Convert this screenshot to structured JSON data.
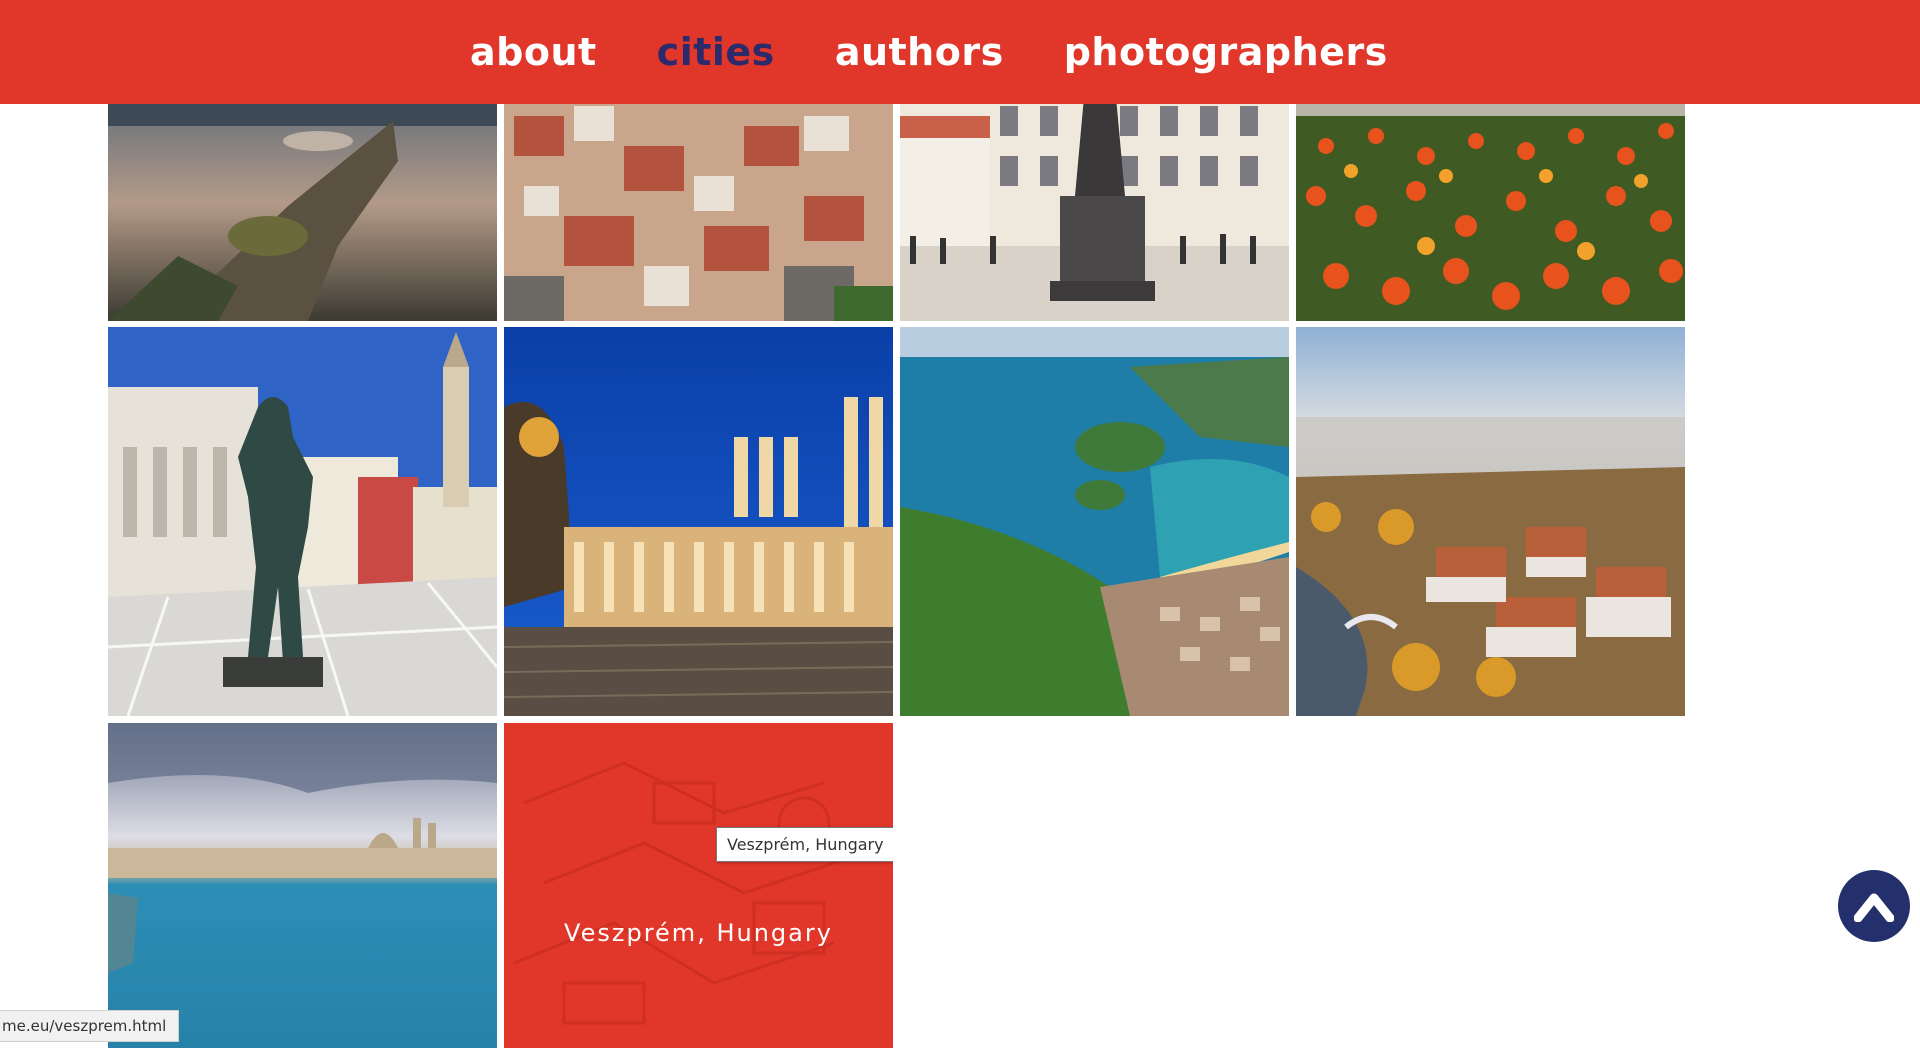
{
  "nav": {
    "items": [
      {
        "label": "about",
        "active": false
      },
      {
        "label": "cities",
        "active": true
      },
      {
        "label": "authors",
        "active": false
      },
      {
        "label": "photographers",
        "active": false
      }
    ]
  },
  "hover_tile": {
    "caption": "Veszprém, Hungary",
    "tooltip": "Veszprém, Hungary"
  },
  "status_bar": {
    "url": "me.eu/veszprem.html"
  },
  "colors": {
    "brand_red": "#e1372a",
    "active_nav": "#2c2a6b",
    "scroll_button": "#23306b"
  },
  "icons": {
    "scroll_top": "chevron-up-icon"
  }
}
